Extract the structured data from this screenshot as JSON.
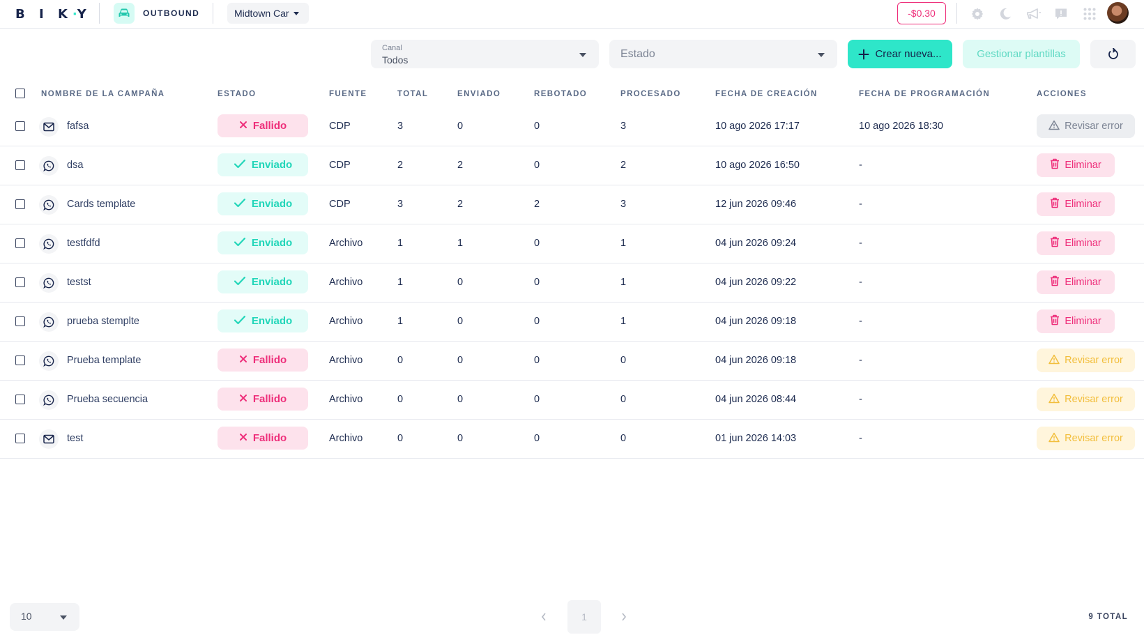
{
  "topbar": {
    "logo": "BIKY",
    "module_label": "OUTBOUND",
    "company": "Midtown Car",
    "balance": "-$0.30",
    "icons": [
      "gear-icon",
      "moon-icon",
      "megaphone-icon",
      "chat-alert-icon",
      "apps-grid-icon"
    ]
  },
  "filters": {
    "canal_label": "Canal",
    "canal_value": "Todos",
    "estado_placeholder": "Estado"
  },
  "buttons": {
    "create": "Crear nueva...",
    "templates": "Gestionar plantillas"
  },
  "table": {
    "columns": [
      "NOMBRE DE LA CAMPAÑA",
      "ESTADO",
      "FUENTE",
      "TOTAL",
      "ENVIADO",
      "REBOTADO",
      "PROCESADO",
      "FECHA DE CREACIÓN",
      "FECHA DE PROGRAMACIÓN",
      "ACCIONES"
    ],
    "rows": [
      {
        "channel": "email",
        "name": "fafsa",
        "status": "Fallido",
        "status_type": "fail",
        "source": "CDP",
        "total": "3",
        "sent": "0",
        "bounced": "0",
        "processed": "3",
        "created": "10 ago 2026 17:17",
        "scheduled": "10 ago 2026 18:30",
        "action": "Revisar error",
        "action_type": "err-grey"
      },
      {
        "channel": "whatsapp",
        "name": "dsa",
        "status": "Enviado",
        "status_type": "ok",
        "source": "CDP",
        "total": "2",
        "sent": "2",
        "bounced": "0",
        "processed": "2",
        "created": "10 ago 2026 16:50",
        "scheduled": "-",
        "action": "Eliminar",
        "action_type": "del"
      },
      {
        "channel": "whatsapp",
        "name": "Cards template",
        "status": "Enviado",
        "status_type": "ok",
        "source": "CDP",
        "total": "3",
        "sent": "2",
        "bounced": "2",
        "processed": "3",
        "created": "12 jun 2026 09:46",
        "scheduled": "-",
        "action": "Eliminar",
        "action_type": "del"
      },
      {
        "channel": "whatsapp",
        "name": "testfdfd",
        "status": "Enviado",
        "status_type": "ok",
        "source": "Archivo",
        "total": "1",
        "sent": "1",
        "bounced": "0",
        "processed": "1",
        "created": "04 jun 2026 09:24",
        "scheduled": "-",
        "action": "Eliminar",
        "action_type": "del"
      },
      {
        "channel": "whatsapp",
        "name": "testst",
        "status": "Enviado",
        "status_type": "ok",
        "source": "Archivo",
        "total": "1",
        "sent": "0",
        "bounced": "0",
        "processed": "1",
        "created": "04 jun 2026 09:22",
        "scheduled": "-",
        "action": "Eliminar",
        "action_type": "del"
      },
      {
        "channel": "whatsapp",
        "name": "prueba stemplte",
        "status": "Enviado",
        "status_type": "ok",
        "source": "Archivo",
        "total": "1",
        "sent": "0",
        "bounced": "0",
        "processed": "1",
        "created": "04 jun 2026 09:18",
        "scheduled": "-",
        "action": "Eliminar",
        "action_type": "del"
      },
      {
        "channel": "whatsapp",
        "name": "Prueba template",
        "status": "Fallido",
        "status_type": "fail",
        "source": "Archivo",
        "total": "0",
        "sent": "0",
        "bounced": "0",
        "processed": "0",
        "created": "04 jun 2026 09:18",
        "scheduled": "-",
        "action": "Revisar error",
        "action_type": "err-yellow"
      },
      {
        "channel": "whatsapp",
        "name": "Prueba secuencia",
        "status": "Fallido",
        "status_type": "fail",
        "source": "Archivo",
        "total": "0",
        "sent": "0",
        "bounced": "0",
        "processed": "0",
        "created": "04 jun 2026 08:44",
        "scheduled": "-",
        "action": "Revisar error",
        "action_type": "err-yellow"
      },
      {
        "channel": "email",
        "name": "test",
        "status": "Fallido",
        "status_type": "fail",
        "source": "Archivo",
        "total": "0",
        "sent": "0",
        "bounced": "0",
        "processed": "0",
        "created": "01 jun 2026 14:03",
        "scheduled": "-",
        "action": "Revisar error",
        "action_type": "err-yellow"
      }
    ]
  },
  "pagination": {
    "page_size": "10",
    "current_page": "1",
    "total": "9 TOTAL"
  },
  "colors": {
    "accent": "#2ee6c9",
    "danger": "#ee2e7a",
    "warning": "#f2be3c",
    "text": "#1d2b4f"
  }
}
